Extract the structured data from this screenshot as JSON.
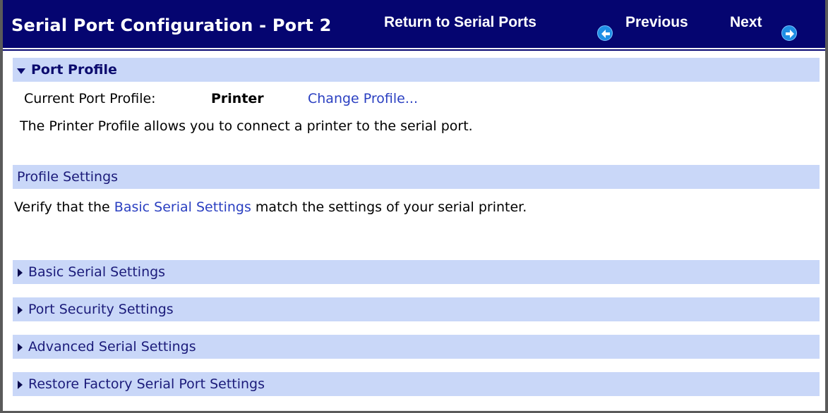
{
  "header": {
    "title": "Serial Port Configuration - Port 2",
    "return_link": "Return to Serial Ports",
    "previous_label": "Previous",
    "next_label": "Next",
    "background_color": "#050570"
  },
  "port_profile": {
    "section_title": "Port Profile",
    "current_label": "Current Port Profile:",
    "current_value": "Printer",
    "change_link": "Change Profile...",
    "description": "The Printer Profile allows you to connect a printer to the serial port."
  },
  "profile_settings": {
    "section_title": "Profile Settings",
    "text_before": "Verify that the",
    "link_text": "Basic Serial Settings",
    "text_after": "match the settings of your serial printer."
  },
  "collapsed_sections": [
    {
      "label": "Basic Serial Settings"
    },
    {
      "label": "Port Security Settings"
    },
    {
      "label": "Advanced Serial Settings"
    },
    {
      "label": "Restore Factory Serial Port Settings"
    }
  ],
  "colors": {
    "section_bar": "#c9d7f8",
    "link": "#2a3fc1",
    "nav_icon": "#1f8fe5"
  }
}
